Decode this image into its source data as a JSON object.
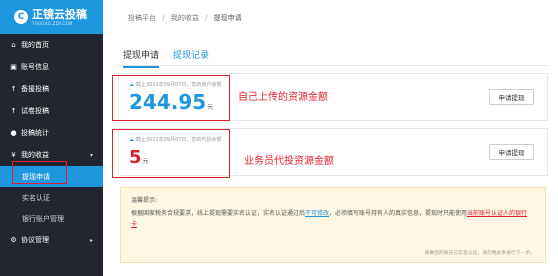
{
  "sidebar": {
    "logo": {
      "mark": "C",
      "title": "正镜云投稿",
      "subtitle": "TOUGAO.ZDY.COM"
    },
    "items": [
      {
        "icon": "home-icon",
        "glyph": "⌂",
        "label": "我的首页"
      },
      {
        "icon": "id-card-icon",
        "glyph": "▣",
        "label": "账号信息"
      },
      {
        "icon": "upload-icon",
        "glyph": "↑",
        "label": "备援投稿"
      },
      {
        "icon": "upload-icon",
        "glyph": "↑",
        "label": "试卷投稿"
      },
      {
        "icon": "chart-icon",
        "glyph": "●",
        "label": "投稿统计"
      },
      {
        "icon": "yen-icon",
        "glyph": "¥",
        "label": "我的收益",
        "caret": "▾"
      }
    ],
    "sub_items": [
      {
        "label": "提现申请",
        "active": true
      },
      {
        "label": "实名认证"
      },
      {
        "label": "银行账户管理"
      }
    ],
    "bottom_item": {
      "icon": "gear-icon",
      "glyph": "⚙",
      "label": "协议管理",
      "caret": "▸"
    }
  },
  "breadcrumb": {
    "items": [
      "投稿平台",
      "我的收益",
      "提现申请"
    ],
    "separator": "/"
  },
  "tabs": [
    {
      "label": "提现申请",
      "active": true
    },
    {
      "label": "提现记录",
      "active": false
    }
  ],
  "cards": [
    {
      "note_icon": "☁",
      "note": "截止2022年09月07日，您的账户余额",
      "amount": "244.95",
      "unit": "元",
      "button": "申请提现",
      "annotation": "自己上传的资源金额"
    },
    {
      "note_icon": "☁",
      "note": "截止2022年09月07日，您的代投余额",
      "amount": "5",
      "unit": "元",
      "button": "申请提现",
      "annotation": "业务员代投资源金额"
    }
  ],
  "notice": {
    "title": "温馨提示:",
    "body_1": "根据国家税务合规要求，线上提现需要实名认证，实名认证通过后",
    "link_1": "不可修改",
    "body_2": "，必须填写账号持有人的真实信息，提现时只能使用",
    "link_2": "当前账号认证人的银行卡",
    "footer": "如果您的账号已实名认证，请勿略此条进行下一步。"
  },
  "colors": {
    "accent": "#1f97df",
    "sidebar_bg": "#23262e",
    "highlight": "#e0202a"
  }
}
